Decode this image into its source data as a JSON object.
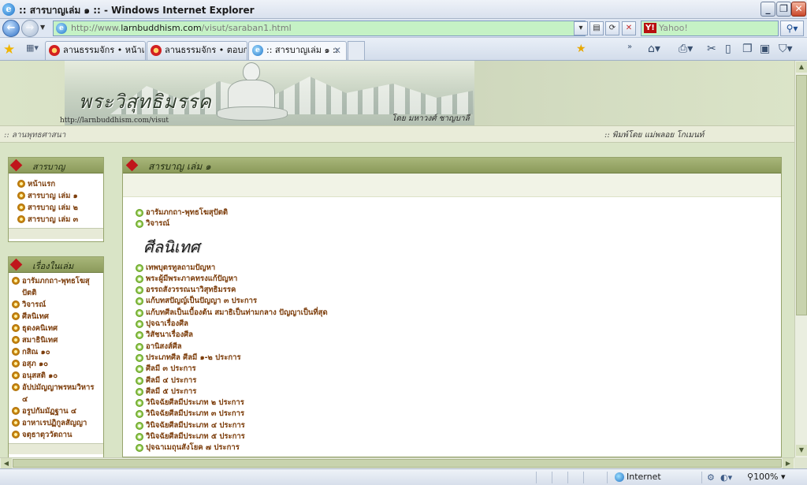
{
  "window": {
    "title": ":: สารบาญเล่ม ๑ :: - Windows Internet Explorer",
    "ie_glyph": "e"
  },
  "address_bar": {
    "url_prefix": "http://www.",
    "url_host": "larnbuddhism.com",
    "url_path": "/visut/saraban1.html",
    "search_placeholder": "Yahoo!",
    "search_logo": "Y!"
  },
  "tabs": [
    {
      "label": "ลานธรรมจักร • หน้าแรก",
      "icon": "dharma-wheel-icon"
    },
    {
      "label": "ลานธรรมจักร • ตอบกร...",
      "icon": "dharma-wheel-icon"
    },
    {
      "label": ":: สารบาญเล่ม ๑ ::",
      "icon": "ie-page-icon",
      "active": true
    }
  ],
  "site": {
    "logo_text": "พระวิสุทธิมรรค",
    "url_caption": "http://larnbuddhism.com/visut",
    "author_caption": "โดย  มหาวงศ์  ชาญบาลี",
    "strip_left": ":: ลานพุทธศาสนา",
    "strip_right": ":: พิมพ์โดย แม่พลอย โกเมนท์"
  },
  "left_panel_1": {
    "title": "สารบาญ",
    "items": [
      "หน้าแรก",
      "สารบาญ เล่ม ๑",
      "สารบาญ เล่ม ๒",
      "สารบาญ เล่ม ๓"
    ]
  },
  "left_panel_2": {
    "title": "เรื่องในเล่ม",
    "items": [
      "อารัมภกถา-พุทธโฆสุปัตติ",
      "วิจารณ์",
      "ศีลนิเทศ",
      "ธุดงคนิเทศ",
      "สมาธินิเทศ",
      "กสิณ ๑๐",
      "อสุภ ๑๐",
      "อนุสสติ ๑๐",
      "อัปปมัญญาพรหมวิหาร ๔",
      "อรูปกัมมัฏฐาน ๔",
      "อาหาเรปฏิกูลสัญญา",
      "จตุธาตุววัตถาน"
    ]
  },
  "main": {
    "title": "สารบาญ เล่ม ๑",
    "intro_links": [
      "อารัมภกถา-พุทธโฆสุปัตติ",
      "วิจารณ์"
    ],
    "section_heading": "ศีลนิเทศ",
    "section_links": [
      "เทพบุตรทูลถามปัญหา",
      "พระผู้มีพระภาคทรงแก้ปัญหา",
      "อรรถสังวรรณนาวิสุทธิมรรค",
      "แก้บทสปัญญ์เป็นปัญญา ๓ ประการ",
      "แก้บทศีลเป็นเบื้องต้น สมาธิเป็นท่ามกลาง ปัญญาเป็นที่สุด",
      "ปุจฉาเรื่องศีล",
      "วิสัชนาเรื่องศีล",
      "อานิสงส์ศีล",
      "ประเภทศีล ศีลมี ๑-๒ ประการ",
      "ศีลมี ๓ ประการ",
      "ศีลมี ๔ ประการ",
      "ศีลมี ๕ ประการ",
      "วินิจฉัยศีลมีประเภท ๒ ประการ",
      "วินิจฉัยศีลมีประเภท ๓ ประการ",
      "วินิจฉัยศีลมีประเภท ๔ ประการ",
      "วินิจฉัยศีลมีประเภท ๕ ประการ",
      "ปุจฉาเมถุนสังโยค ๗ ประการ"
    ]
  },
  "status_bar": {
    "zone": "Internet",
    "zoom": "100%"
  }
}
